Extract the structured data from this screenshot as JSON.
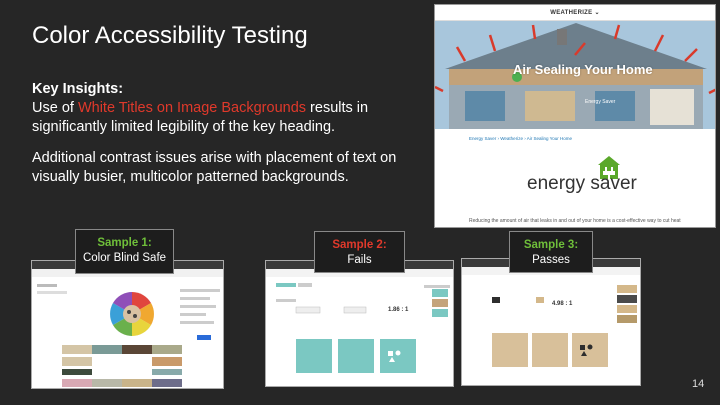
{
  "slide": {
    "title": "Color Accessibility Testing",
    "insights_heading": "Key Insights:",
    "insight1_pre": "Use of ",
    "insight1_highlight": "White Titles on Image Backgrounds",
    "insight1_post": " results in significantly limited legibility of the key heading.",
    "insight2": "Additional contrast issues arise with placement of text on visually busier, multicolor patterned backgrounds.",
    "page_number": "14",
    "highlight_color": "#e0392b"
  },
  "screenshot": {
    "nav_label": "WEATHERIZE",
    "hero_title": "Air Sealing Your Home",
    "hero_sub": "Energy Saver",
    "breadcrumb": "Energy Saver › Weatherize › Air Sealing Your Home",
    "brand_word1": "energy",
    "brand_word2": "saver",
    "body_text": "Reducing the amount of air that leaks in and out of your home is a cost-effective way to cut heat"
  },
  "samples": [
    {
      "title": "Sample 1:",
      "verdict": "Color Blind Safe",
      "title_color": "#6fbf3a"
    },
    {
      "title": "Sample 2:",
      "verdict": "Fails",
      "title_color": "#e0392b"
    },
    {
      "title": "Sample 3:",
      "verdict": "Passes",
      "title_color": "#6fbf3a"
    }
  ],
  "sample2_ratio": "1.86 : 1",
  "sample3_ratio": "4.98 : 1"
}
